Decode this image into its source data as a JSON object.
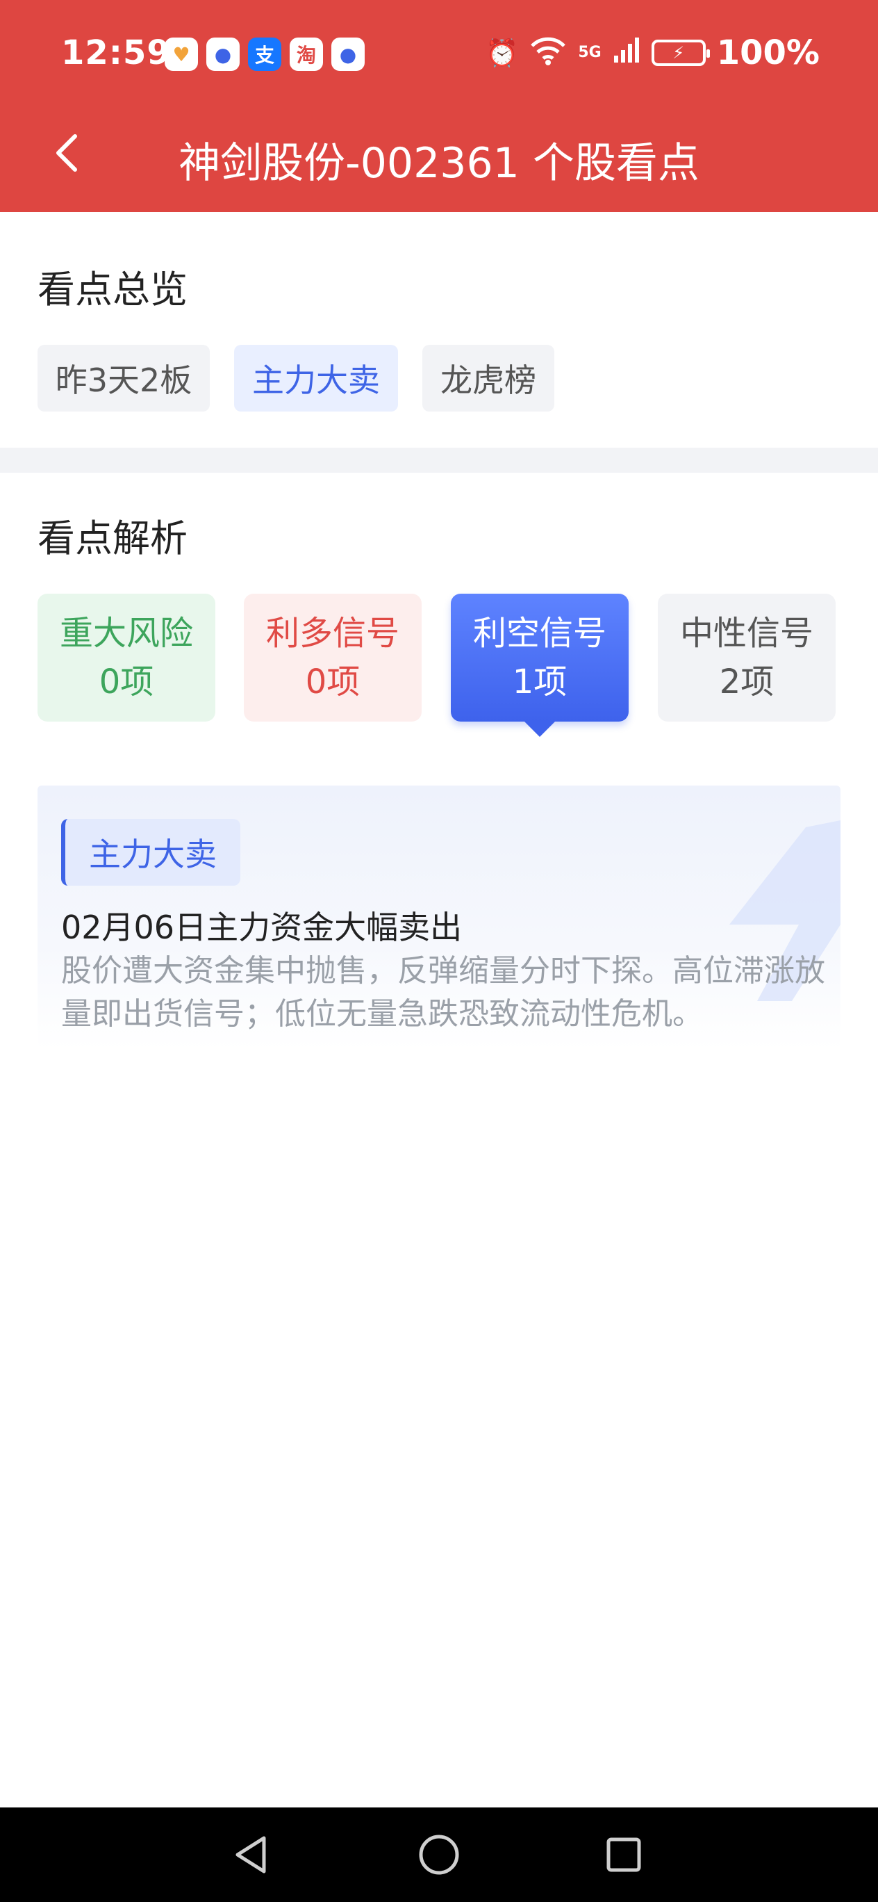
{
  "status_bar": {
    "time": "12:59",
    "battery": "100%",
    "network": "5G",
    "app_icons": [
      "heart-app-icon",
      "browser-icon",
      "alipay-icon",
      "taobao-icon",
      "browser-icon"
    ]
  },
  "nav": {
    "title": "神剑股份-002361 个股看点"
  },
  "overview": {
    "title": "看点总览",
    "tags": [
      {
        "label": "昨3天2板",
        "style": "gray"
      },
      {
        "label": "主力大卖",
        "style": "blue"
      },
      {
        "label": "龙虎榜",
        "style": "gray"
      }
    ]
  },
  "analysis": {
    "title": "看点解析",
    "signals": [
      {
        "name": "重大风险",
        "count": "0项",
        "color": "#3da55c"
      },
      {
        "name": "利多信号",
        "count": "0项",
        "color": "#e04a45"
      },
      {
        "name": "利空信号",
        "count": "1项",
        "selected": true
      },
      {
        "name": "中性信号",
        "count": "2项",
        "color": "#555555"
      }
    ]
  },
  "detail": {
    "tag": "主力大卖",
    "title": "02月06日主力资金大幅卖出",
    "description": "股价遭大资金集中抛售，反弹缩量分时下探。高位滞涨放量即出货信号；低位无量急跌恐致流动性危机。"
  },
  "colors": {
    "header_red": "#de4641",
    "accent_blue": "#3e64e6"
  }
}
